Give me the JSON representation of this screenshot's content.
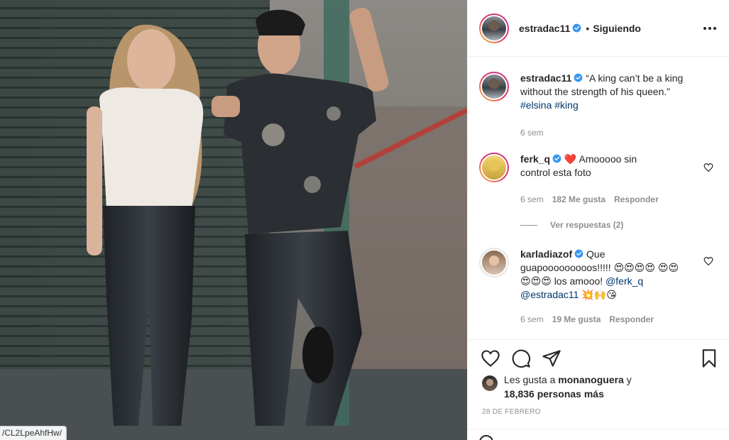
{
  "photo": {
    "url_chip": "/CL2LpeAhfHw/"
  },
  "header": {
    "username": "estradac11",
    "separator": "•",
    "follow_state": "Siguiendo"
  },
  "caption": {
    "username": "estradac11",
    "text": "“A king can’t be a king without the strength of his queen.”",
    "hashtags": [
      "#elsina",
      "#king"
    ],
    "time": "6 sem"
  },
  "comments": [
    {
      "username": "ferk_q",
      "heart_emoji": "❤️",
      "text": "Amooooo sin control esta foto",
      "time": "6 sem",
      "likes": "182 Me gusta",
      "reply": "Responder",
      "view_replies": "Ver respuestas (2)"
    },
    {
      "username": "karladiazof",
      "text_start": "Que guapooooooooos!!!!!",
      "emojis_row1": "😍😍😍😍",
      "emojis_row2": "😍😍😍😍😍",
      "text_mid": "los amooo!",
      "mention1": "@ferk_q",
      "mention2": "@estradac11",
      "emojis_end": "💥🙌😘",
      "time": "6 sem",
      "likes": "19 Me gusta",
      "reply": "Responder"
    }
  ],
  "likes": {
    "prefix": "Les gusta a",
    "user": "monanoguera",
    "connector": "y",
    "others": "18,836 personas más"
  },
  "date": "28 DE FEBRERO",
  "icons": [
    "heart-icon",
    "comment-icon",
    "share-icon",
    "bookmark-icon",
    "more-options-icon",
    "verified-badge-icon",
    "emoji-icon"
  ],
  "colors": {
    "text": "#262626",
    "secondary": "#8e8e8e",
    "link": "#00376b",
    "verified": "#3897f0",
    "border": "#efefef"
  }
}
